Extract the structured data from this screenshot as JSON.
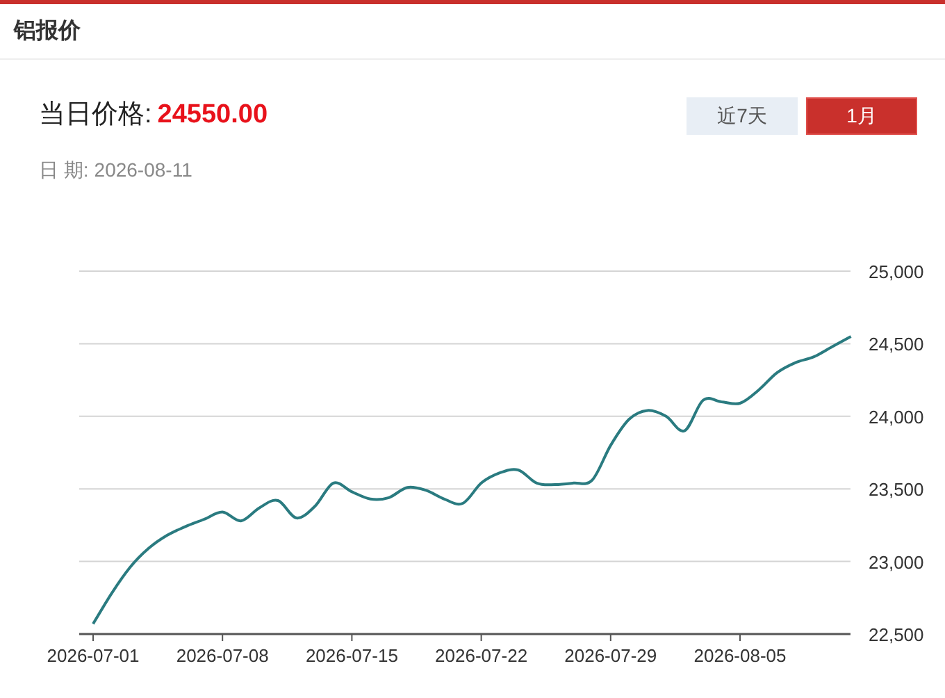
{
  "header": {
    "title": "铝报价"
  },
  "price": {
    "label": "当日价格:",
    "value": "24550.00"
  },
  "date": {
    "label": "日 期:",
    "value": "2026-08-11"
  },
  "ranges": [
    {
      "label": "近7天",
      "selected": false
    },
    {
      "label": "1月",
      "selected": true
    }
  ],
  "chart_data": {
    "type": "line",
    "grid": true,
    "categories": [
      "2026-07-01",
      null,
      null,
      null,
      null,
      null,
      null,
      "2026-07-08",
      null,
      null,
      null,
      null,
      null,
      null,
      "2026-07-15",
      null,
      null,
      null,
      null,
      null,
      null,
      "2026-07-22",
      null,
      null,
      null,
      null,
      null,
      null,
      "2026-07-29",
      null,
      null,
      null,
      null,
      null,
      null,
      "2026-08-05",
      null,
      null,
      null,
      null,
      null,
      null
    ],
    "series": [
      {
        "color": "#2a7b80",
        "values": [
          22570,
          22780,
          22960,
          23090,
          23180,
          23240,
          23290,
          23340,
          23280,
          23370,
          23420,
          23300,
          23380,
          23540,
          23480,
          23430,
          23440,
          23510,
          23490,
          23430,
          23400,
          23540,
          23610,
          23630,
          23540,
          23530,
          23540,
          23560,
          23800,
          23980,
          24040,
          24000,
          23900,
          24110,
          24100,
          24090,
          24180,
          24300,
          24370,
          24410,
          24480,
          24550
        ]
      }
    ],
    "ylim": [
      22500,
      25000
    ],
    "yticks": [
      {
        "value": 22500,
        "label": "22,500"
      },
      {
        "value": 23000,
        "label": "23,000"
      },
      {
        "value": 23500,
        "label": "23,500"
      },
      {
        "value": 24000,
        "label": "24,000"
      },
      {
        "value": 24500,
        "label": "24,500"
      },
      {
        "value": 25000,
        "label": "25,000"
      }
    ]
  }
}
